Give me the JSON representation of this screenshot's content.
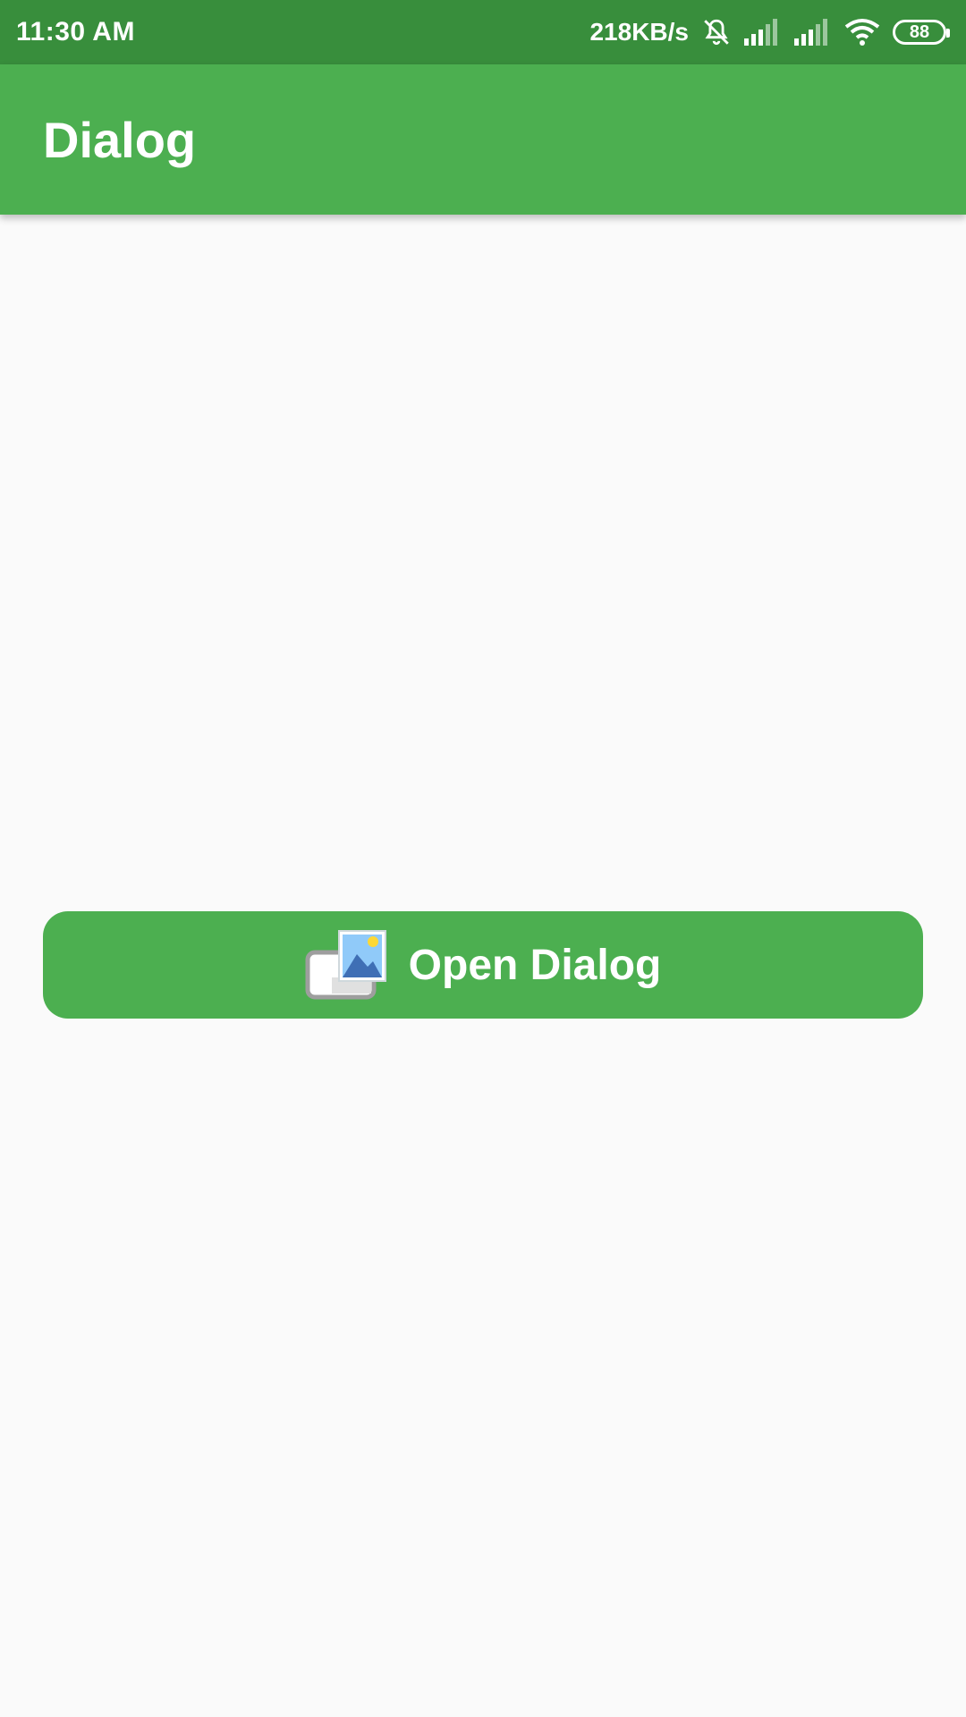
{
  "status_bar": {
    "time": "11:30 AM",
    "network_speed": "218KB/s",
    "battery_level": "88",
    "icons": [
      "muted-bell-icon",
      "signal-icon",
      "signal-icon",
      "wifi-icon",
      "battery-icon"
    ]
  },
  "app_bar": {
    "title": "Dialog"
  },
  "main": {
    "open_button_label": "Open Dialog",
    "open_button_icon": "gallery-image-icon"
  },
  "colors": {
    "status_bar": "#388e3c",
    "primary": "#4caf50",
    "background": "#fafafa"
  }
}
